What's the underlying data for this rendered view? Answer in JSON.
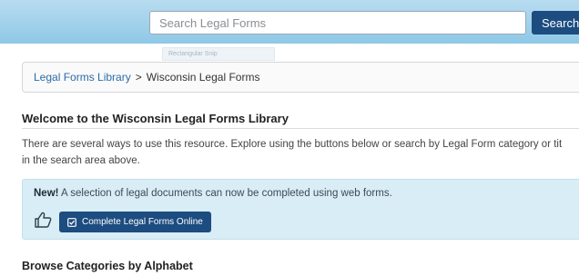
{
  "search": {
    "placeholder": "Search Legal Forms",
    "button_label": "Search"
  },
  "ghost_tooltip": "Rectangular Snip",
  "breadcrumb": {
    "link_label": "Legal Forms Library",
    "separator": ">",
    "current": "Wisconsin Legal Forms"
  },
  "page": {
    "title": "Welcome to the Wisconsin Legal Forms Library",
    "intro_line1": "There are several ways to use this resource. Explore using the buttons below or search by Legal Form category or tit",
    "intro_line2": "in the search area above."
  },
  "notice": {
    "badge": "New!",
    "text": " A selection of legal documents can now be completed using web forms.",
    "button_label": "Complete Legal Forms Online",
    "button_icon": "check-square-icon",
    "hint_icon": "thumbs-up-outline-icon"
  },
  "browse": {
    "title": "Browse Categories by Alphabet"
  },
  "colors": {
    "header_top": "#b8dcf0",
    "header_bottom": "#8ec8e6",
    "primary_button": "#1c4c80",
    "link": "#2a6ba8",
    "notice_bg": "#d9edf6"
  }
}
